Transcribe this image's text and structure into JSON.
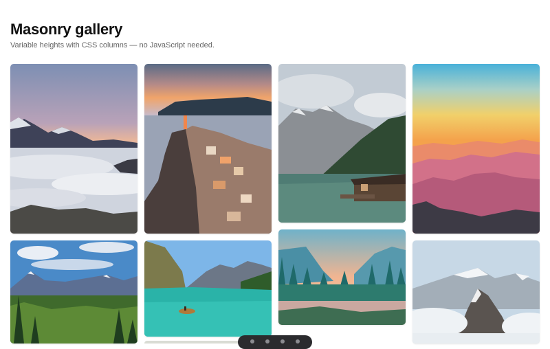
{
  "header": {
    "title": "Masonry gallery",
    "subtitle": "Variable heights with CSS columns — no JavaScript needed."
  },
  "gallery": {
    "tiles": [
      {
        "name": "photo-mountain-sea-of-clouds"
      },
      {
        "name": "photo-cliffside-village-sunset"
      },
      {
        "name": "photo-lake-cabin-mountains"
      },
      {
        "name": "photo-layered-mountains-sunset"
      },
      {
        "name": "photo-alpine-meadow-peaks"
      },
      {
        "name": "photo-turquoise-lake-boat"
      },
      {
        "name": "photo-misty-forest-lake"
      },
      {
        "name": "photo-snowy-peaks-clouds"
      }
    ]
  },
  "colors": {
    "background": "#ffffff",
    "title": "#111111",
    "subtitle": "#666666",
    "toolbar": "#2b2b2e"
  }
}
